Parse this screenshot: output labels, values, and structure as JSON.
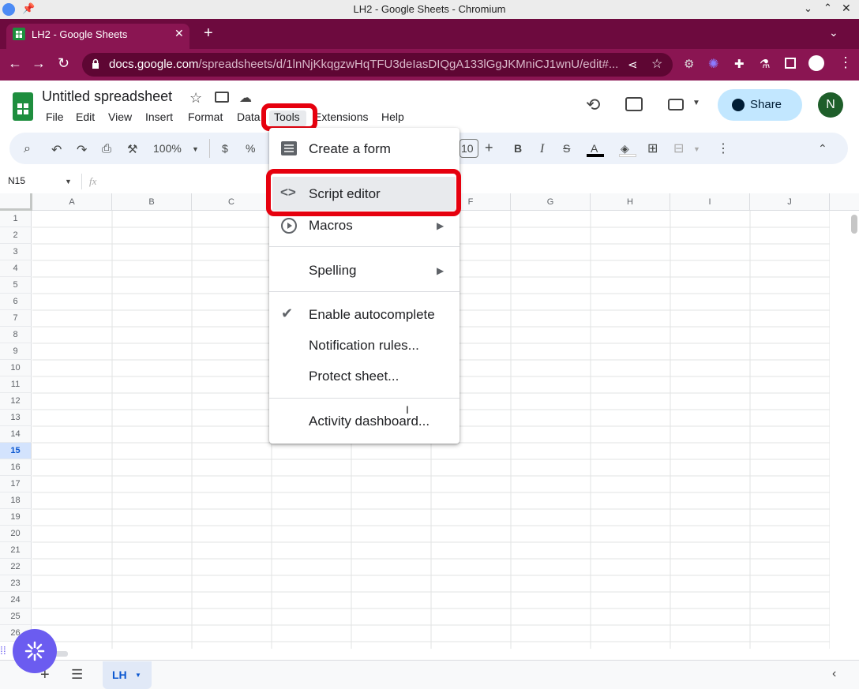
{
  "window": {
    "title": "LH2 - Google Sheets - Chromium"
  },
  "browser": {
    "tab_title": "LH2 - Google Sheets",
    "url_host": "docs.google.com",
    "url_path": "/spreadsheets/d/1lnNjKkqgzwHqTFU3deIasDIQgA133lGgJKMniCJ1wnU/edit#..."
  },
  "doc": {
    "title": "Untitled spreadsheet",
    "menus": [
      "File",
      "Edit",
      "View",
      "Insert",
      "Format",
      "Data",
      "Tools",
      "Extensions",
      "Help"
    ],
    "share_label": "Share",
    "avatar_initial": "N"
  },
  "toolbar": {
    "zoom": "100%",
    "currency": "$",
    "percent": "%",
    "font_size": "10",
    "bold": "B",
    "italic": "I",
    "text_color": "A"
  },
  "formula_bar": {
    "cell_ref": "N15",
    "fx": "fx"
  },
  "grid": {
    "columns": [
      "A",
      "B",
      "C",
      "D",
      "E",
      "F",
      "G",
      "H",
      "I",
      "J"
    ],
    "rows": [
      "1",
      "2",
      "3",
      "4",
      "5",
      "6",
      "7",
      "8",
      "9",
      "10",
      "11",
      "12",
      "13",
      "14",
      "15",
      "16",
      "17",
      "18",
      "19",
      "20",
      "21",
      "22",
      "23",
      "24",
      "25",
      "26"
    ],
    "selected_row": "15"
  },
  "tools_menu": {
    "items": [
      {
        "label": "Create a form",
        "icon": "form-icon"
      },
      {
        "label": "Script editor",
        "icon": "code-icon"
      },
      {
        "label": "Macros",
        "icon": "play-circle-icon",
        "submenu": true
      },
      {
        "label": "Spelling",
        "submenu": true
      },
      {
        "label": "Enable autocomplete",
        "checked": true
      },
      {
        "label": "Notification rules..."
      },
      {
        "label": "Protect sheet..."
      },
      {
        "label": "Activity dashboard..."
      }
    ]
  },
  "sheets": {
    "active_tab": "LH"
  },
  "colors": {
    "brand_bar": "#8a1552",
    "highlight": "#e6000e",
    "share_bg": "#c2e7ff"
  }
}
